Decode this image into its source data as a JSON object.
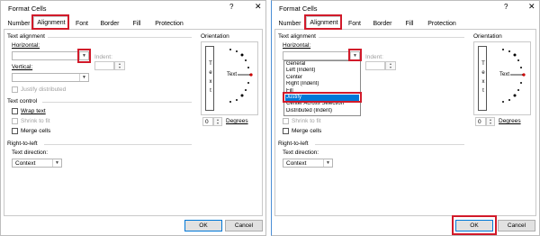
{
  "left_dialog": {
    "title": "Format Cells",
    "help_glyph": "?",
    "close_glyph": "✕",
    "tabs": [
      "Number",
      "Alignment",
      "Font",
      "Border",
      "Fill",
      "Protection"
    ],
    "active_tab": "Alignment",
    "text_alignment": {
      "section_label": "Text alignment",
      "horizontal_label": "Horizontal:",
      "horizontal_value": "",
      "indent_label": "Indent:",
      "indent_value": "",
      "vertical_label": "Vertical:",
      "vertical_value": "",
      "justify_distributed_label": "Justify distributed",
      "justify_distributed_checked": false
    },
    "text_control": {
      "section_label": "Text control",
      "wrap_text_label": "Wrap text",
      "wrap_text_checked": false,
      "shrink_to_fit_label": "Shrink to fit",
      "merge_cells_label": "Merge cells",
      "merge_cells_checked": false
    },
    "right_to_left": {
      "section_label": "Right-to-left",
      "text_direction_label": "Text direction:",
      "text_direction_value": "Context"
    },
    "orientation": {
      "label": "Orientation",
      "vertical_text": [
        "T",
        "e",
        "x",
        "t"
      ],
      "text_label": "Text",
      "degrees_value": "0",
      "degrees_label": "Degrees"
    },
    "ok_label": "OK",
    "cancel_label": "Cancel",
    "highlights": [
      "Alignment tab",
      "Horizontal dropdown arrow"
    ]
  },
  "right_dialog": {
    "title": "Format Cells",
    "help_glyph": "?",
    "close_glyph": "✕",
    "tabs": [
      "Number",
      "Alignment",
      "Font",
      "Border",
      "Fill",
      "Protection"
    ],
    "active_tab": "Alignment",
    "text_alignment": {
      "section_label": "Text alignment",
      "horizontal_label": "Horizontal:",
      "indent_label": "Indent:",
      "dropdown_options": [
        "General",
        "Left (Indent)",
        "Center",
        "Right (Indent)",
        "Fill",
        "Justify",
        "Center Across Selection",
        "Distributed (Indent)"
      ],
      "selected_option": "Justify"
    },
    "text_control": {
      "shrink_to_fit_label": "Shrink to fit",
      "merge_cells_label": "Merge cells"
    },
    "right_to_left": {
      "section_label": "Right-to-left",
      "text_direction_label": "Text direction:",
      "text_direction_value": "Context"
    },
    "orientation": {
      "label": "Orientation",
      "vertical_text": [
        "T",
        "e",
        "x",
        "t"
      ],
      "text_label": "Text",
      "degrees_value": "0",
      "degrees_label": "Degrees"
    },
    "ok_label": "OK",
    "cancel_label": "Cancel",
    "highlights": [
      "Alignment tab",
      "Horizontal dropdown arrow",
      "Justify option",
      "OK button"
    ]
  },
  "colors": {
    "highlight": "#d11a2a",
    "selection": "#0078d7",
    "window_accent": "#4a8ed6"
  }
}
